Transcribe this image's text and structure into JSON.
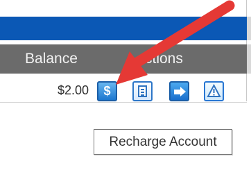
{
  "grid": {
    "header": {
      "balance_label": "Balance",
      "actions_label": "ctions"
    },
    "row": {
      "balance_value": "$2.00",
      "recharge_button_symbol": "$",
      "actions": [
        {
          "name": "recharge-account-button",
          "icon": "dollar-icon"
        },
        {
          "name": "details-button",
          "icon": "document-icon"
        },
        {
          "name": "go-button",
          "icon": "arrow-right-icon"
        },
        {
          "name": "warning-button",
          "icon": "warning-icon"
        }
      ]
    }
  },
  "tooltip": {
    "text": "Recharge Account"
  },
  "colors": {
    "title_bar": "#0b58b5",
    "header_bar": "#6b6b6b",
    "pointer_arrow": "#e53935",
    "button_blue": "#1c77cf"
  }
}
